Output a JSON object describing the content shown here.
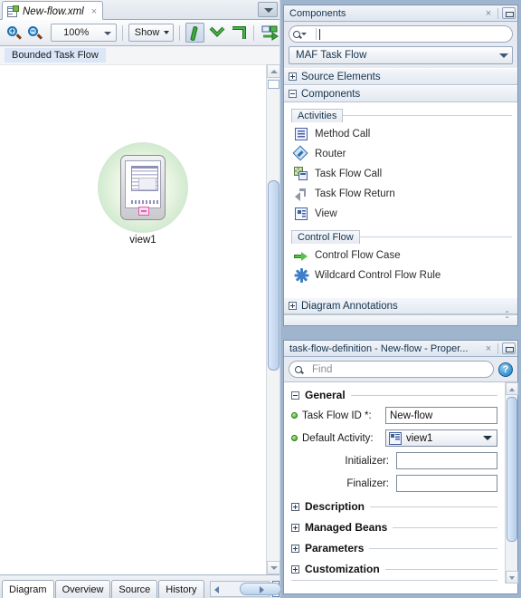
{
  "editor": {
    "tab": {
      "title": "New-flow.xml",
      "close": "×",
      "icon": "xml-file-icon"
    },
    "toolbar": {
      "zoom_in": "zoom-in",
      "zoom_out": "zoom-out",
      "zoom_value": "100%",
      "show_label": "Show",
      "tools": [
        "straight-line-tool",
        "elbow-line-tool",
        "orthogonal-line-tool",
        "publish-diagram-tool"
      ]
    },
    "breadcrumb": "Bounded Task Flow",
    "diagram": {
      "node_label": "view1"
    },
    "bottom_tabs": [
      {
        "label": "Diagram",
        "active": true
      },
      {
        "label": "Overview",
        "active": false
      },
      {
        "label": "Source",
        "active": false
      },
      {
        "label": "History",
        "active": false
      }
    ]
  },
  "components_panel": {
    "title": "Components",
    "close": "×",
    "search_value": "",
    "search_placeholder": "",
    "selector_value": "MAF Task Flow",
    "sections": [
      {
        "label": "Source Elements",
        "expanded": false
      },
      {
        "label": "Components",
        "expanded": true
      },
      {
        "label": "Diagram Annotations",
        "expanded": false
      }
    ],
    "groups": [
      {
        "caption": "Activities",
        "items": [
          {
            "label": "Method Call",
            "icon": "method-call-icon"
          },
          {
            "label": "Router",
            "icon": "router-icon"
          },
          {
            "label": "Task Flow Call",
            "icon": "task-flow-call-icon"
          },
          {
            "label": "Task Flow Return",
            "icon": "task-flow-return-icon"
          },
          {
            "label": "View",
            "icon": "view-icon"
          }
        ]
      },
      {
        "caption": "Control Flow",
        "items": [
          {
            "label": "Control Flow Case",
            "icon": "control-flow-case-icon"
          },
          {
            "label": "Wildcard Control Flow Rule",
            "icon": "wildcard-control-flow-rule-icon"
          }
        ]
      }
    ]
  },
  "properties_panel": {
    "title": "task-flow-definition - New-flow - Proper...",
    "close": "×",
    "find_placeholder": "Find",
    "find_value": "",
    "help": "?",
    "general": {
      "title": "General",
      "expanded": true,
      "fields": [
        {
          "label": "Task Flow ID *:",
          "value": "New-flow",
          "type": "text",
          "required": true
        },
        {
          "label": "Default Activity:",
          "value": "view1",
          "type": "combo",
          "required": true,
          "icon": "view-icon"
        },
        {
          "label": "Initializer:",
          "value": "",
          "type": "text",
          "required": false
        },
        {
          "label": "Finalizer:",
          "value": "",
          "type": "text",
          "required": false
        }
      ]
    },
    "collapsed_sections": [
      {
        "label": "Description"
      },
      {
        "label": "Managed Beans"
      },
      {
        "label": "Parameters"
      },
      {
        "label": "Customization"
      }
    ]
  },
  "colors": {
    "accent": "#1a74b8",
    "node_halo": "#c8e4c6",
    "required_dot": "#3b9e21",
    "breadcrumb_bg": "#dbe6f7"
  }
}
